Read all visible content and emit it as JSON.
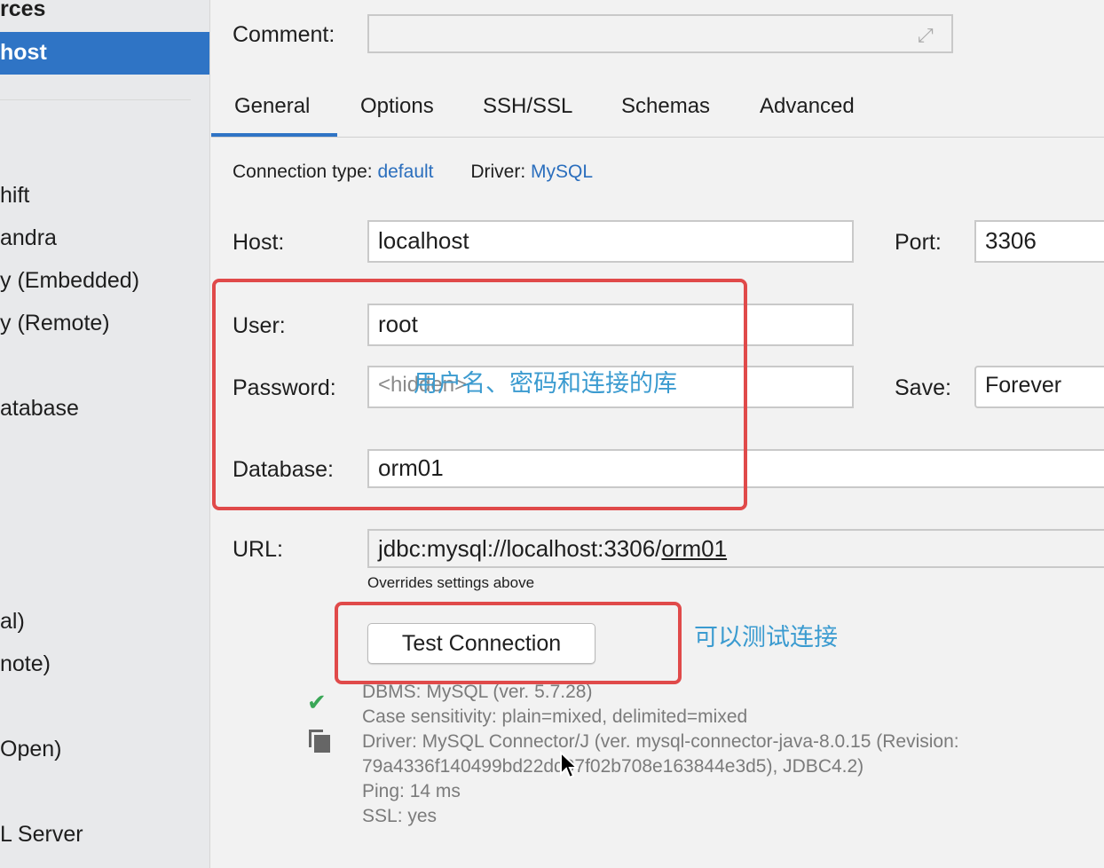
{
  "sidebar": {
    "header": "rces",
    "selected": "host",
    "items": [
      "hift",
      "andra",
      "y (Embedded)",
      "y (Remote)",
      "atabase",
      "al)",
      "note)",
      "Open)",
      "L Server"
    ]
  },
  "comment": {
    "label": "Comment:",
    "value": ""
  },
  "tabs": [
    {
      "label": "General",
      "active": true
    },
    {
      "label": "Options"
    },
    {
      "label": "SSH/SSL"
    },
    {
      "label": "Schemas"
    },
    {
      "label": "Advanced"
    }
  ],
  "connection": {
    "type_label": "Connection type:",
    "type_value": "default",
    "driver_label": "Driver:",
    "driver_value": "MySQL"
  },
  "form": {
    "host_label": "Host:",
    "host": "localhost",
    "port_label": "Port:",
    "port": "3306",
    "user_label": "User:",
    "user": "root",
    "password_label": "Password:",
    "password_placeholder": "<hidden>",
    "save_label": "Save:",
    "save": "Forever",
    "database_label": "Database:",
    "database": "orm01",
    "url_label": "URL:",
    "url_prefix": "jdbc:mysql://localhost:3306/",
    "url_db": "orm01",
    "url_hint": "Overrides settings above"
  },
  "test_button": "Test Connection",
  "annotations": {
    "credentials": "用户名、密码和连接的库",
    "test": "可以测试连接"
  },
  "result": [
    "DBMS: MySQL (ver. 5.7.28)",
    "Case sensitivity: plain=mixed, delimited=mixed",
    "Driver: MySQL Connector/J (ver. mysql-connector-java-8.0.15 (Revision:",
    "79a4336f140499bd22dd07f02b708e163844e3d5), JDBC4.2)",
    "Ping: 14 ms",
    "SSL: yes"
  ],
  "colors": {
    "accent": "#2f74c5",
    "annotation_box": "#e04a4a",
    "annotation_text": "#3b9bd0",
    "success": "#3aa757"
  }
}
